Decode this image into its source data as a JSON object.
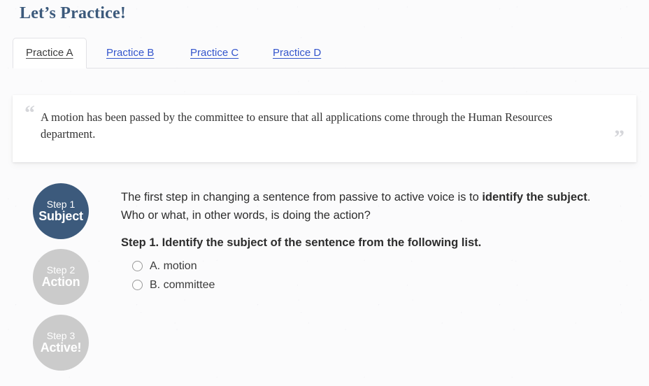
{
  "header": {
    "title": "Let’s Practice!"
  },
  "tabs": [
    {
      "label": "Practice A",
      "active": true
    },
    {
      "label": "Practice B",
      "active": false
    },
    {
      "label": "Practice C",
      "active": false
    },
    {
      "label": "Practice D",
      "active": false
    }
  ],
  "quote": {
    "open_mark": "“",
    "close_mark": "”",
    "text": "A motion has been passed by the committee to ensure that all applications come through the Human Resources department."
  },
  "steps": [
    {
      "number": "Step 1",
      "label": "Subject",
      "state": "active"
    },
    {
      "number": "Step 2",
      "label": "Action",
      "state": "inactive"
    },
    {
      "number": "Step 3",
      "label": "Active!",
      "state": "inactive"
    }
  ],
  "main": {
    "intro_before": "The first step in changing a sentence from passive to active voice is to ",
    "intro_bold": "identify the subject",
    "intro_after": ". Who or what, in other words, is doing the action?",
    "prompt": "Step 1. Identify the subject of the sentence from the following list.",
    "options": [
      {
        "label": "A. motion",
        "selected": false
      },
      {
        "label": "B. committee",
        "selected": false
      }
    ]
  },
  "colors": {
    "brand_blue": "#3c5a7c",
    "link_blue": "#3355cc",
    "inactive_grey": "#cbcbcb",
    "page_bg": "#fbfbfc",
    "card_bg": "#ffffff",
    "quote_mark_grey": "#d5d6da"
  }
}
